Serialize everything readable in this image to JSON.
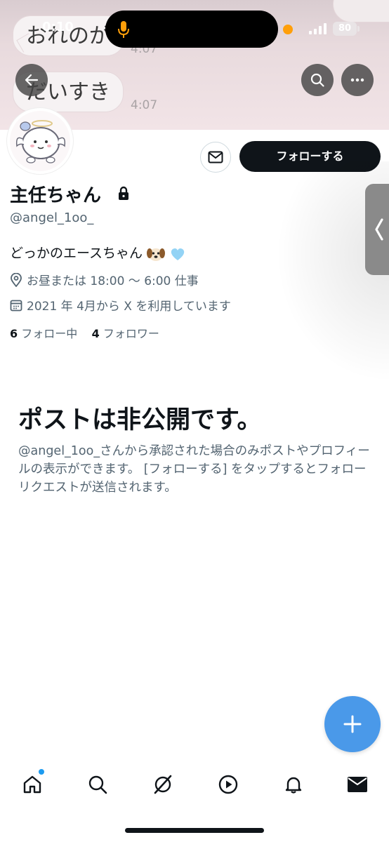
{
  "status_bar": {
    "time": "0:10",
    "battery": "80"
  },
  "banner": {
    "messages": [
      {
        "text": "おれのが",
        "time": "4:07"
      },
      {
        "text": "だいすき",
        "time": "4:07"
      }
    ]
  },
  "header": {
    "back_icon": "arrow-left-icon",
    "search_icon": "search-icon",
    "more_icon": "more-icon"
  },
  "profile": {
    "display_name": "主任ちゃん",
    "handle": "@angel_1oo_",
    "bio": "どっかのエースちゃん",
    "bio_emojis": [
      "dog-face",
      "light-blue-heart"
    ],
    "location": "お昼または 18:00 〜 6:00 仕事",
    "joined": "2021 年 4月から X を利用しています",
    "following_count": "6",
    "following_label": "フォロー中",
    "followers_count": "4",
    "followers_label": "フォロワー",
    "follow_button": "フォローする"
  },
  "private_notice": {
    "title": "ポストは非公開です。",
    "body": "@angel_1oo_さんから承認された場合のみポストやプロフィールの表示ができます。 [フォローする] をタップするとフォローリクエストが送信されます。"
  },
  "nav": {
    "tabs": [
      "home",
      "search",
      "grok",
      "video",
      "notifications",
      "messages"
    ]
  },
  "colors": {
    "accent": "#1d9bf0",
    "fab": "#4a99e9",
    "text": "#0f1419",
    "secondary": "#536471"
  }
}
